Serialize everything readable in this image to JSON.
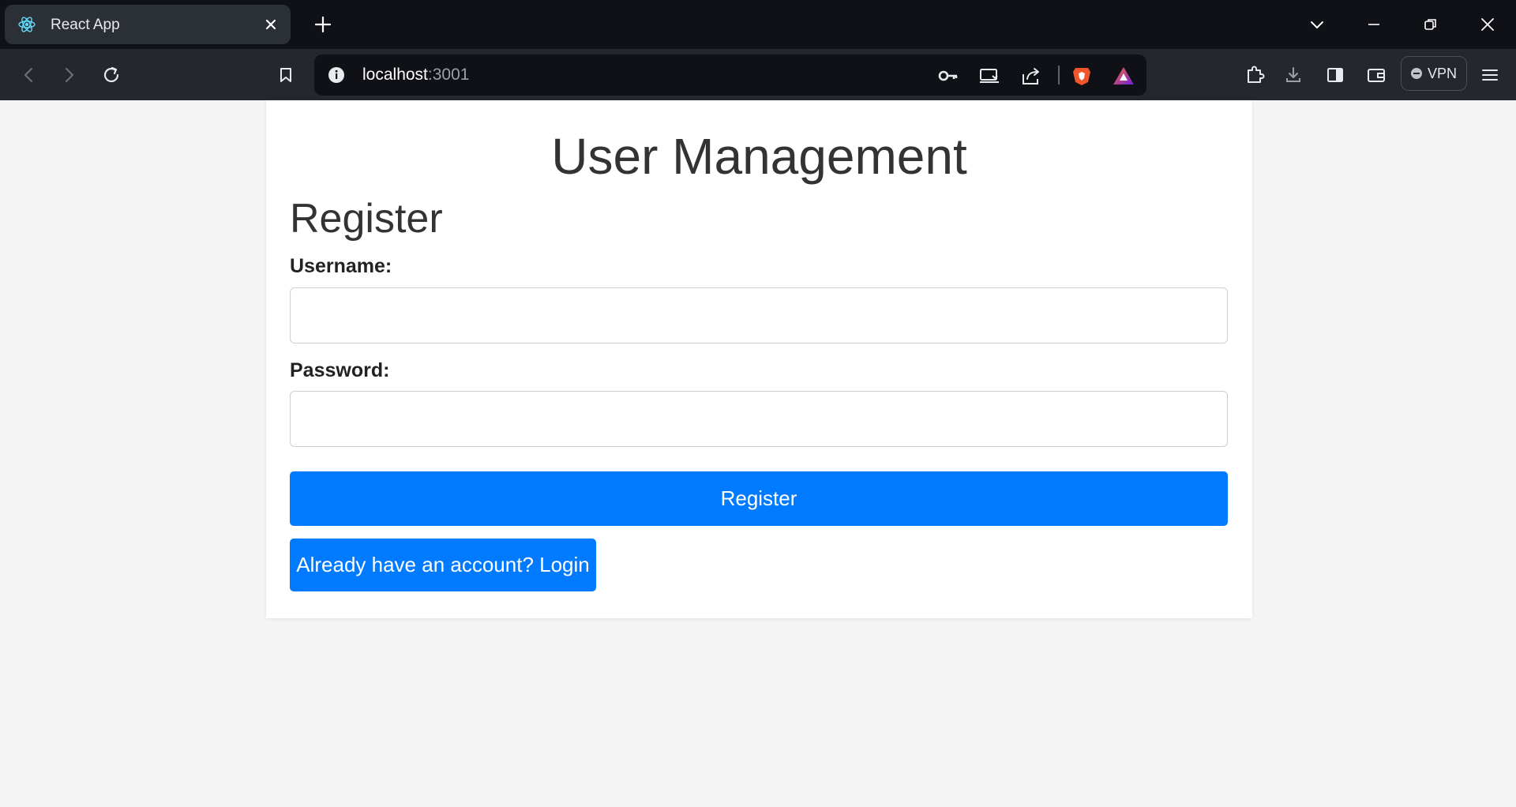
{
  "browser": {
    "tab": {
      "title": "React App",
      "favicon": "react-logo-icon"
    },
    "address": {
      "host": "localhost",
      "port": ":3001"
    },
    "vpn_label": "VPN",
    "icons": {
      "back": "back-arrow-icon",
      "forward": "forward-arrow-icon",
      "reload": "reload-icon",
      "bookmark": "bookmark-icon",
      "key": "key-icon",
      "cast": "cast-icon",
      "share": "share-icon",
      "brave": "brave-lion-icon",
      "rewards": "brave-rewards-icon",
      "extensions": "puzzle-icon",
      "downloads": "download-icon",
      "sidebar": "sidebar-icon",
      "wallet": "wallet-icon",
      "menu": "hamburger-menu-icon"
    }
  },
  "page": {
    "title": "User Management",
    "section_title": "Register",
    "username": {
      "label": "Username:",
      "value": ""
    },
    "password": {
      "label": "Password:",
      "value": ""
    },
    "register_button": "Register",
    "login_link_button": "Already have an account? Login"
  },
  "colors": {
    "accent": "#007bff",
    "page_background": "#f4f4f4",
    "card_background": "#ffffff",
    "chrome_dark": "#0f1116",
    "chrome_toolbar": "#24272d"
  }
}
